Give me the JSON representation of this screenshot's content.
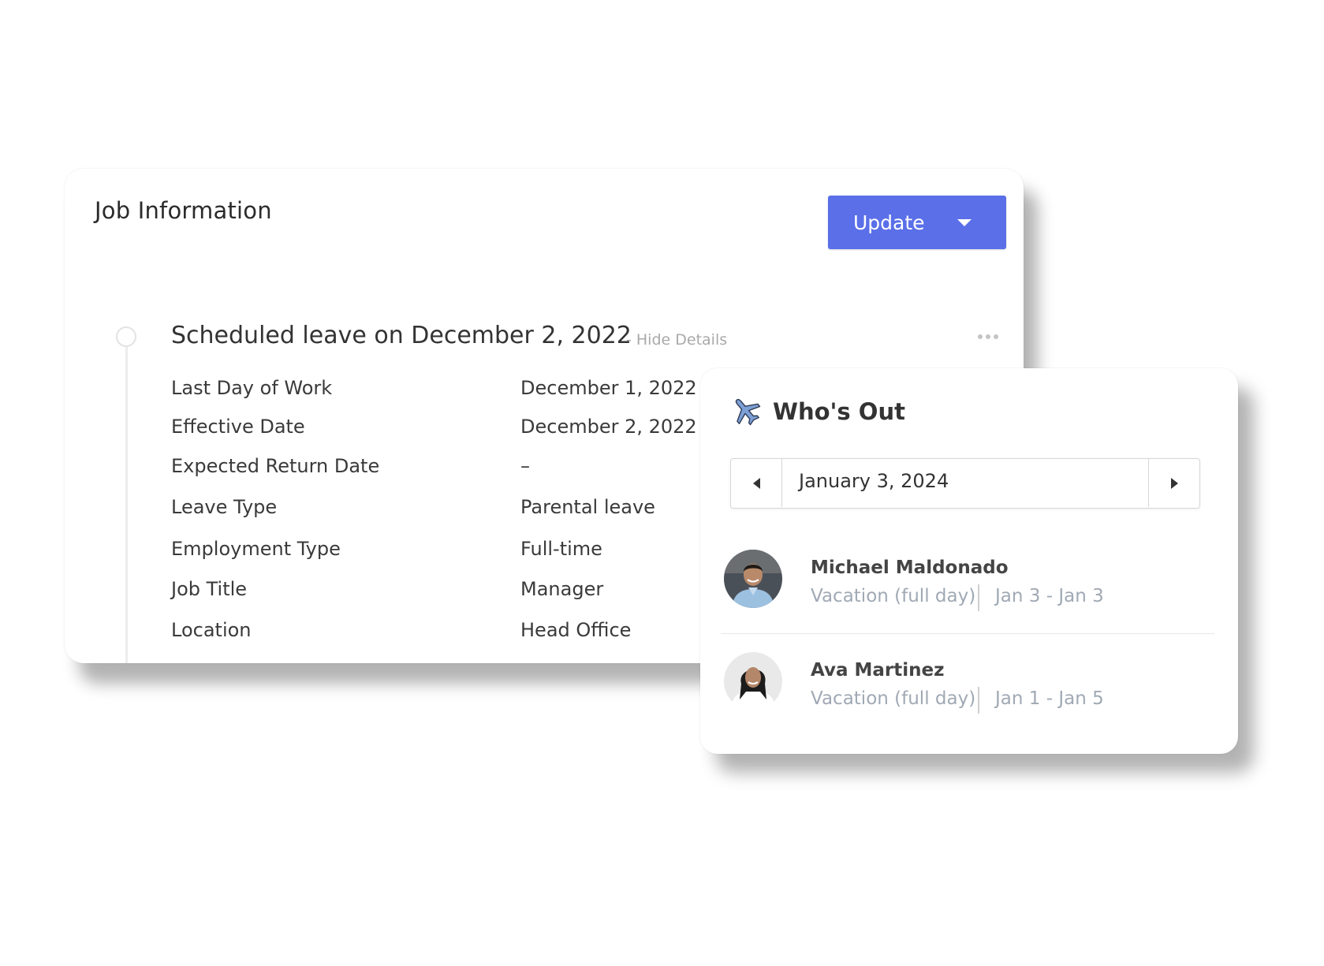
{
  "job_info": {
    "title": "Job Information",
    "update_label": "Update",
    "leave_heading": "Scheduled leave on December 2, 2022",
    "hide_details": "- Hide Details",
    "details": [
      {
        "label": "Last Day of Work",
        "value": "December 1, 2022"
      },
      {
        "label": "Effective Date",
        "value": "December 2, 2022"
      },
      {
        "label": "Expected Return Date",
        "value": "–"
      },
      {
        "label": "Leave Type",
        "value": "Parental leave"
      },
      {
        "label": "Employment Type",
        "value": "Full-time"
      },
      {
        "label": "Job Title",
        "value": "Manager"
      },
      {
        "label": "Location",
        "value": "Head Office"
      }
    ]
  },
  "whos_out": {
    "title": "Who's Out",
    "icon": "airplane-icon",
    "date": "January 3, 2024",
    "people": [
      {
        "name": "Michael Maldonado",
        "type": "Vacation (full day)",
        "dates": "Jan 3 - Jan 3"
      },
      {
        "name": "Ava Martinez",
        "type": "Vacation (full day)",
        "dates": "Jan 1 - Jan 5"
      }
    ]
  },
  "colors": {
    "accent": "#5a6fe8",
    "muted_text": "#a0a9b4",
    "plane": "#7c9fd6"
  }
}
